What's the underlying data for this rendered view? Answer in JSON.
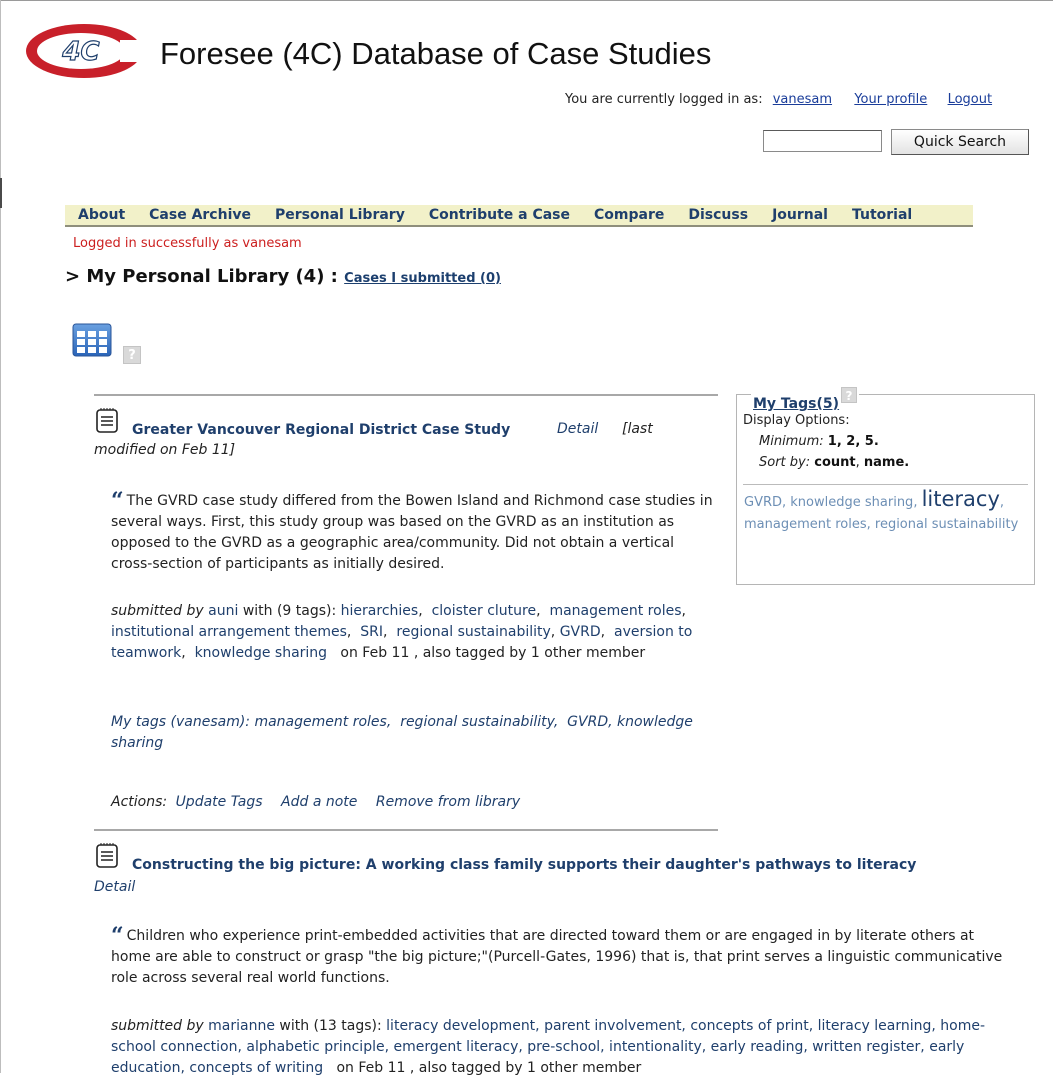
{
  "header": {
    "logo_text": "4C",
    "site_title": "Foresee (4C) Database of Case Studies",
    "login_prefix": "You are currently logged in as:",
    "username": "vanesam",
    "profile_link": "Your profile",
    "logout_link": "Logout",
    "search_placeholder": "",
    "search_button": "Quick Search"
  },
  "nav": {
    "items": [
      "About",
      "Case Archive",
      "Personal Library",
      "Contribute a Case",
      "Compare",
      "Discuss",
      "Journal",
      "Tutorial"
    ]
  },
  "status_message": "Logged in successfully as vanesam",
  "library": {
    "heading": "> My Personal Library (4) :",
    "submitted_link": "Cases I submitted (0)",
    "help_glyph": "?"
  },
  "cases": [
    {
      "title": "Greater Vancouver Regional District Case Study",
      "detail": "Detail",
      "modified": "[last modified on Feb 11]",
      "modified_line1": "[last",
      "modified_line2": "modified on Feb 11]",
      "quote_mark": "“",
      "quote": "The GVRD case study differed from the Bowen Island and Richmond case studies in several ways. First, this study group was based on the GVRD as an institution as opposed to the GVRD as a geographic area/community. Did not obtain a vertical cross-section of participants as initially desired.",
      "submitted_by_label": "submitted by",
      "submitter": "auni",
      "tag_count_text": "with (9 tags):",
      "tags": [
        "hierarchies",
        "cloister cluture",
        "management roles",
        "institutional arrangement themes",
        "SRI",
        "regional sustainability",
        "GVRD",
        "aversion to teamwork",
        "knowledge sharing"
      ],
      "submitted_suffix": "on Feb 11 , also tagged by 1 other member",
      "my_tags_label": "My tags (vanesam):",
      "my_tags": [
        "management roles",
        "regional sustainability",
        "GVRD",
        "knowledge sharing"
      ],
      "actions_label": "Actions:",
      "actions": [
        "Update Tags",
        "Add a note",
        "Remove from library"
      ]
    },
    {
      "title": "Constructing the big picture: A working class family supports their daughter's pathways to literacy",
      "detail": "Detail",
      "quote_mark": "“",
      "quote": "Children who experience print-embedded activities that are directed toward them or are engaged in by literate others at home are able to construct or grasp \"the big picture;\"(Purcell-Gates, 1996) that is, that print serves a linguistic communicative role across several real world functions.",
      "submitted_by_label": "submitted by",
      "submitter": "marianne",
      "tag_count_text": "with (13 tags):",
      "tags_text": "literacy development,  parent involvement,  concepts of print,  literacy learning,  home-school connection,  alphabetic principle,  emergent literacy,  pre-school,  intentionality,  early reading,  written register,  early education,  concepts of writing",
      "submitted_suffix": "on Feb 11 , also tagged by 1 other member"
    }
  ],
  "my_tags_box": {
    "title": "My Tags(5)",
    "display_options": "Display Options:",
    "minimum_label": "Minimum:",
    "minimum_values": "1, 2, 5.",
    "sort_label": "Sort by:",
    "sort_count": "count",
    "sort_name": "name.",
    "tags": [
      {
        "name": "GVRD",
        "size": "normal"
      },
      {
        "name": "knowledge sharing",
        "size": "normal"
      },
      {
        "name": "literacy",
        "size": "big"
      },
      {
        "name": "management roles",
        "size": "normal"
      },
      {
        "name": "regional sustainability",
        "size": "normal"
      }
    ]
  },
  "colors": {
    "nav_bg": "#f2f1c9",
    "link_dark": "#1f3f6c",
    "status_red": "#cc1f1f",
    "logo_red": "#c8202a"
  }
}
